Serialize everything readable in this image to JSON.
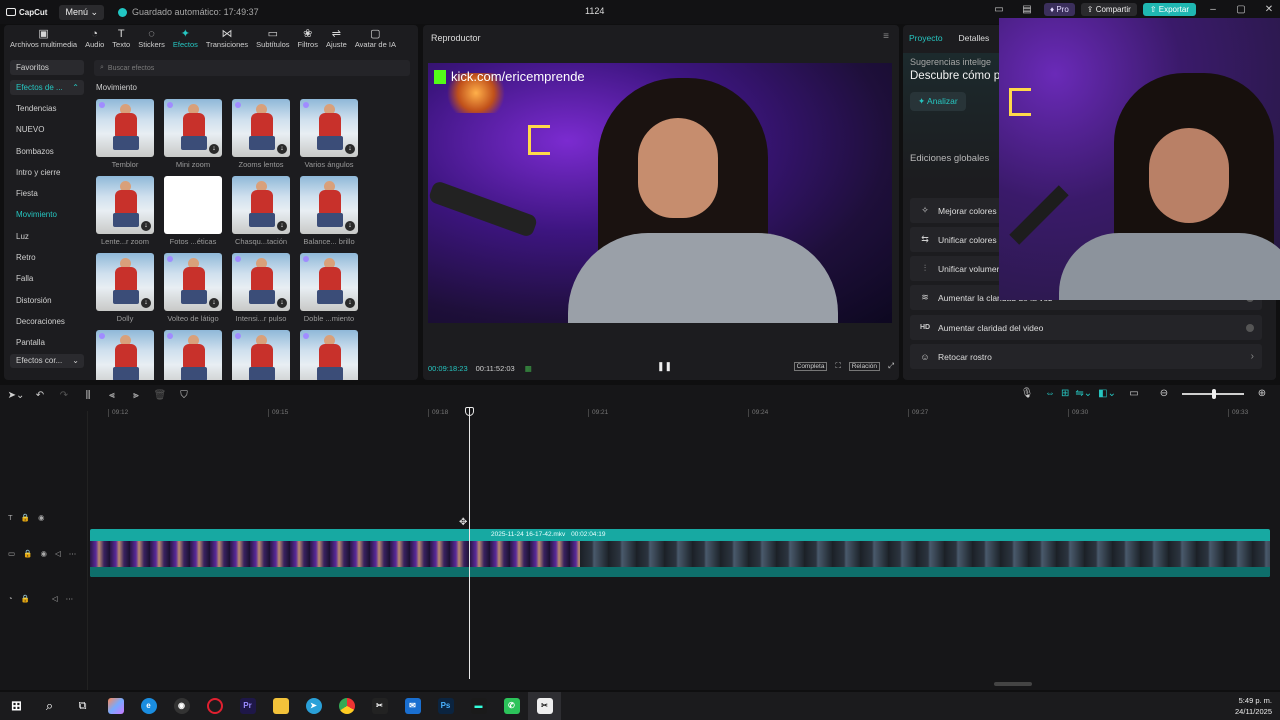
{
  "titlebar": {
    "app": "CapCut",
    "menu": "Menú",
    "autosave": "Guardado automático: 17:49:37",
    "project": "1124",
    "pro": "Pro",
    "share": "Compartir",
    "export": "Exportar"
  },
  "tools": [
    {
      "label": "Archivos multimedia",
      "icon": "media-icon"
    },
    {
      "label": "Audio",
      "icon": "audio-icon"
    },
    {
      "label": "Texto",
      "icon": "text-icon"
    },
    {
      "label": "Stickers",
      "icon": "sticker-icon"
    },
    {
      "label": "Efectos",
      "icon": "effects-icon"
    },
    {
      "label": "Transiciones",
      "icon": "transition-icon"
    },
    {
      "label": "Subtítulos",
      "icon": "subtitle-icon"
    },
    {
      "label": "Filtros",
      "icon": "filter-icon"
    },
    {
      "label": "Ajuste",
      "icon": "adjust-icon"
    },
    {
      "label": "Avatar de IA",
      "icon": "avatar-icon"
    }
  ],
  "categories": {
    "favorites": "Favoritos",
    "group": "Efectos de ...",
    "items": [
      "Tendencias",
      "NUEVO",
      "Bombazos",
      "Intro y cierre",
      "Fiesta",
      "Movimiento",
      "Luz",
      "Retro",
      "Falla",
      "Distorsión",
      "Decoraciones",
      "Pantalla"
    ],
    "more": "Efectos cor..."
  },
  "search": {
    "placeholder": "Buscar efectos"
  },
  "section": "Movimiento",
  "effects": [
    {
      "label": "Temblor"
    },
    {
      "label": "Mini zoom"
    },
    {
      "label": "Zooms lentos"
    },
    {
      "label": "Varios ángulos"
    },
    {
      "label": "Lente...r zoom"
    },
    {
      "label": "Fotos ...éticas"
    },
    {
      "label": "Chasqu...tación"
    },
    {
      "label": "Balance... brillo"
    },
    {
      "label": "Dolly"
    },
    {
      "label": "Volteo de látigo"
    },
    {
      "label": "Intensi...r pulso"
    },
    {
      "label": "Doble ...miento"
    },
    {
      "label": ""
    },
    {
      "label": ""
    },
    {
      "label": ""
    },
    {
      "label": ""
    }
  ],
  "player": {
    "title": "Reproductor",
    "overlay_text": "kick.com/ericemprende",
    "time_current": "00:09:18:23",
    "time_total": "00:11:52:03",
    "full_label": "Completa",
    "ratio_label": "Relación"
  },
  "right_panel": {
    "tab_project": "Proyecto",
    "tab_details": "Detalles",
    "suggest_title": "Sugerencias intelige",
    "suggest_sub": "Descubre cómo p",
    "analyze": "Analizar",
    "global_title": "Ediciones globales",
    "options": [
      {
        "label": "Mejorar colores",
        "icon": "color-icon"
      },
      {
        "label": "Unificar colores",
        "icon": "unify-icon"
      },
      {
        "label": "Unificar volumen",
        "icon": "volume-icon"
      },
      {
        "label": "Aumentar la claridad de la voz",
        "icon": "voice-icon"
      },
      {
        "label": "Aumentar claridad del video",
        "icon": "hd-icon"
      },
      {
        "label": "Retocar rostro",
        "icon": "face-icon"
      }
    ]
  },
  "timeline": {
    "ticks": [
      "09:12",
      "09:15",
      "09:18",
      "09:21",
      "09:24",
      "09:27",
      "09:30",
      "09:33"
    ],
    "clip_name": "2025-11-24 16-17-42.mkv",
    "clip_duration": "00:02:04:19"
  },
  "taskbar": {
    "time": "5:49 p. m.",
    "date": "24/11/2025"
  },
  "colors": {
    "accent": "#26c6c1",
    "clip": "#17a9a2",
    "export": "#1fb7b2"
  }
}
